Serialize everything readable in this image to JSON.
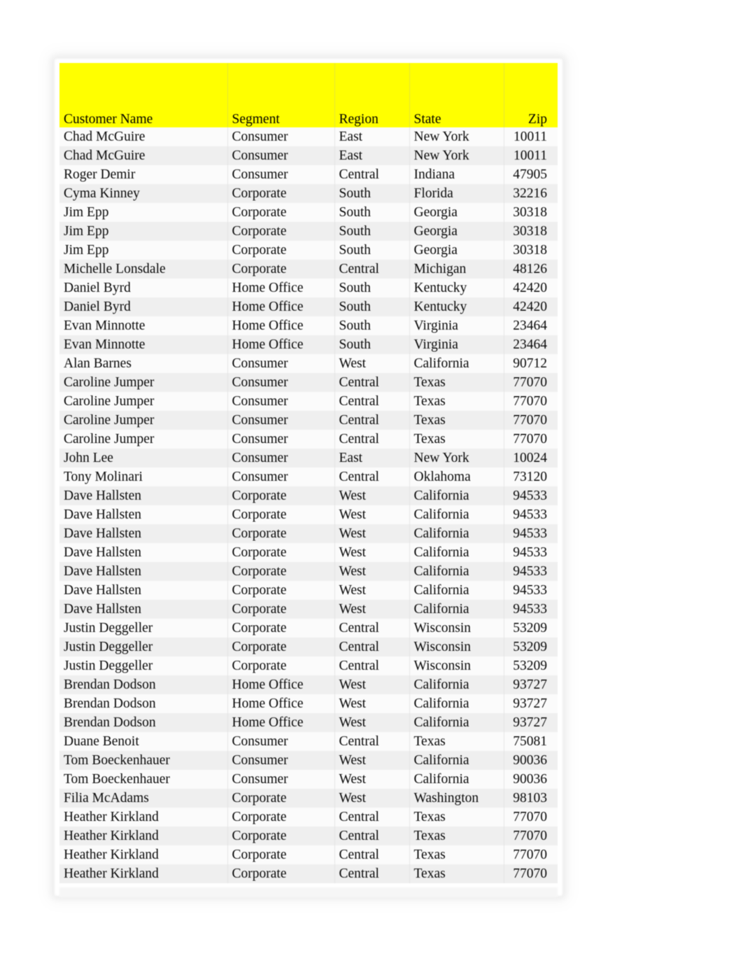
{
  "sheet": {
    "banner_color": "#FFFF00",
    "banner_blank_rows": 2,
    "columns": [
      {
        "key": "name",
        "label": "Customer Name",
        "align": "left"
      },
      {
        "key": "segment",
        "label": "Segment",
        "align": "left"
      },
      {
        "key": "region",
        "label": "Region",
        "align": "left"
      },
      {
        "key": "state",
        "label": "State",
        "align": "left"
      },
      {
        "key": "zip",
        "label": "Zip",
        "align": "right"
      }
    ],
    "rows": [
      {
        "name": "Chad McGuire",
        "segment": "Consumer",
        "region": "East",
        "state": "New York",
        "zip": "10011"
      },
      {
        "name": "Chad McGuire",
        "segment": "Consumer",
        "region": "East",
        "state": "New York",
        "zip": "10011"
      },
      {
        "name": "Roger Demir",
        "segment": "Consumer",
        "region": "Central",
        "state": "Indiana",
        "zip": "47905"
      },
      {
        "name": "Cyma Kinney",
        "segment": "Corporate",
        "region": "South",
        "state": "Florida",
        "zip": "32216"
      },
      {
        "name": "Jim Epp",
        "segment": "Corporate",
        "region": "South",
        "state": "Georgia",
        "zip": "30318"
      },
      {
        "name": "Jim Epp",
        "segment": "Corporate",
        "region": "South",
        "state": "Georgia",
        "zip": "30318"
      },
      {
        "name": "Jim Epp",
        "segment": "Corporate",
        "region": "South",
        "state": "Georgia",
        "zip": "30318"
      },
      {
        "name": "Michelle Lonsdale",
        "segment": "Corporate",
        "region": "Central",
        "state": "Michigan",
        "zip": "48126"
      },
      {
        "name": "Daniel Byrd",
        "segment": "Home Office",
        "region": "South",
        "state": "Kentucky",
        "zip": "42420"
      },
      {
        "name": "Daniel Byrd",
        "segment": "Home Office",
        "region": "South",
        "state": "Kentucky",
        "zip": "42420"
      },
      {
        "name": "Evan Minnotte",
        "segment": "Home Office",
        "region": "South",
        "state": "Virginia",
        "zip": "23464"
      },
      {
        "name": "Evan Minnotte",
        "segment": "Home Office",
        "region": "South",
        "state": "Virginia",
        "zip": "23464"
      },
      {
        "name": "Alan Barnes",
        "segment": "Consumer",
        "region": "West",
        "state": "California",
        "zip": "90712"
      },
      {
        "name": "Caroline Jumper",
        "segment": "Consumer",
        "region": "Central",
        "state": "Texas",
        "zip": "77070"
      },
      {
        "name": "Caroline Jumper",
        "segment": "Consumer",
        "region": "Central",
        "state": "Texas",
        "zip": "77070"
      },
      {
        "name": "Caroline Jumper",
        "segment": "Consumer",
        "region": "Central",
        "state": "Texas",
        "zip": "77070"
      },
      {
        "name": "Caroline Jumper",
        "segment": "Consumer",
        "region": "Central",
        "state": "Texas",
        "zip": "77070"
      },
      {
        "name": "John Lee",
        "segment": "Consumer",
        "region": "East",
        "state": "New York",
        "zip": "10024"
      },
      {
        "name": "Tony Molinari",
        "segment": "Consumer",
        "region": "Central",
        "state": "Oklahoma",
        "zip": "73120"
      },
      {
        "name": "Dave Hallsten",
        "segment": "Corporate",
        "region": "West",
        "state": "California",
        "zip": "94533"
      },
      {
        "name": "Dave Hallsten",
        "segment": "Corporate",
        "region": "West",
        "state": "California",
        "zip": "94533"
      },
      {
        "name": "Dave Hallsten",
        "segment": "Corporate",
        "region": "West",
        "state": "California",
        "zip": "94533"
      },
      {
        "name": "Dave Hallsten",
        "segment": "Corporate",
        "region": "West",
        "state": "California",
        "zip": "94533"
      },
      {
        "name": "Dave Hallsten",
        "segment": "Corporate",
        "region": "West",
        "state": "California",
        "zip": "94533"
      },
      {
        "name": "Dave Hallsten",
        "segment": "Corporate",
        "region": "West",
        "state": "California",
        "zip": "94533"
      },
      {
        "name": "Dave Hallsten",
        "segment": "Corporate",
        "region": "West",
        "state": "California",
        "zip": "94533"
      },
      {
        "name": "Justin Deggeller",
        "segment": "Corporate",
        "region": "Central",
        "state": "Wisconsin",
        "zip": "53209"
      },
      {
        "name": "Justin Deggeller",
        "segment": "Corporate",
        "region": "Central",
        "state": "Wisconsin",
        "zip": "53209"
      },
      {
        "name": "Justin Deggeller",
        "segment": "Corporate",
        "region": "Central",
        "state": "Wisconsin",
        "zip": "53209"
      },
      {
        "name": "Brendan Dodson",
        "segment": "Home Office",
        "region": "West",
        "state": "California",
        "zip": "93727"
      },
      {
        "name": "Brendan Dodson",
        "segment": "Home Office",
        "region": "West",
        "state": "California",
        "zip": "93727"
      },
      {
        "name": "Brendan Dodson",
        "segment": "Home Office",
        "region": "West",
        "state": "California",
        "zip": "93727"
      },
      {
        "name": "Duane Benoit",
        "segment": "Consumer",
        "region": "Central",
        "state": "Texas",
        "zip": "75081"
      },
      {
        "name": "Tom Boeckenhauer",
        "segment": "Consumer",
        "region": "West",
        "state": "California",
        "zip": "90036"
      },
      {
        "name": "Tom Boeckenhauer",
        "segment": "Consumer",
        "region": "West",
        "state": "California",
        "zip": "90036"
      },
      {
        "name": "Filia McAdams",
        "segment": "Corporate",
        "region": "West",
        "state": "Washington",
        "zip": "98103"
      },
      {
        "name": "Heather Kirkland",
        "segment": "Corporate",
        "region": "Central",
        "state": "Texas",
        "zip": "77070"
      },
      {
        "name": "Heather Kirkland",
        "segment": "Corporate",
        "region": "Central",
        "state": "Texas",
        "zip": "77070"
      },
      {
        "name": "Heather Kirkland",
        "segment": "Corporate",
        "region": "Central",
        "state": "Texas",
        "zip": "77070"
      },
      {
        "name": "Heather Kirkland",
        "segment": "Corporate",
        "region": "Central",
        "state": "Texas",
        "zip": "77070"
      }
    ]
  }
}
